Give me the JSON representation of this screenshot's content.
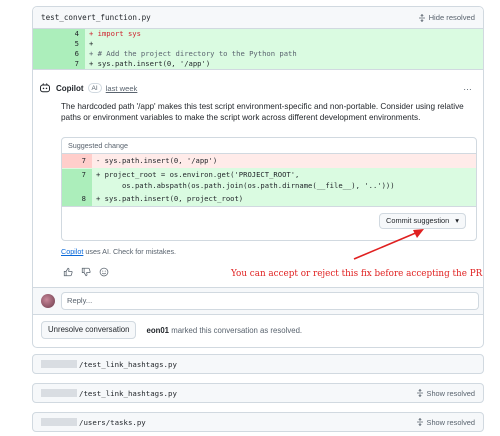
{
  "thread": {
    "filename": "test_convert_function.py",
    "hide_label": "Hide resolved",
    "diff_lines": [
      {
        "num": "4",
        "code": "+ import sys"
      },
      {
        "num": "5",
        "code": "+"
      },
      {
        "num": "6",
        "code": "+ # Add the project directory to the Python path"
      },
      {
        "num": "7",
        "code": "+ sys.path.insert(0, '/app')"
      }
    ]
  },
  "comment": {
    "author": "Copilot",
    "badge": "AI",
    "time": "last week",
    "menu": "…",
    "body": "The hardcoded path '/app' makes this test script environment-specific and non-portable. Consider using relative paths or environment variables to make the script work across different development environments."
  },
  "suggestion": {
    "title": "Suggested change",
    "removed": {
      "num": "7",
      "code": "- sys.path.insert(0, '/app')"
    },
    "added_1": {
      "num": "7",
      "line1": "+ project_root = os.environ.get('PROJECT_ROOT',",
      "line2": "      os.path.abspath(os.path.join(os.path.dirname(__file__), '..')))"
    },
    "added_2": {
      "num": "8",
      "code": "+ sys.path.insert(0, project_root)"
    },
    "commit_label": "Commit suggestion",
    "commit_caret": "▾"
  },
  "disclaimer": {
    "link": "Copilot",
    "text": " uses AI. Check for mistakes."
  },
  "annotation": "You can accept or reject this fix before accepting the PR",
  "reply": {
    "placeholder": "Reply..."
  },
  "resolution": {
    "button": "Unresolve conversation",
    "user": "eon01",
    "text": " marked this conversation as resolved."
  },
  "files": [
    {
      "path": "/test_link_hashtags.py",
      "show_label": ""
    },
    {
      "path": "/test_link_hashtags.py",
      "show_label": "Show resolved"
    },
    {
      "path": "/users/tasks.py",
      "show_label": "Show resolved"
    }
  ],
  "colors": {
    "annotation": "#e02020",
    "link": "#0969da",
    "added_bg": "#dafbe1",
    "removed_bg": "#ffebe9"
  }
}
